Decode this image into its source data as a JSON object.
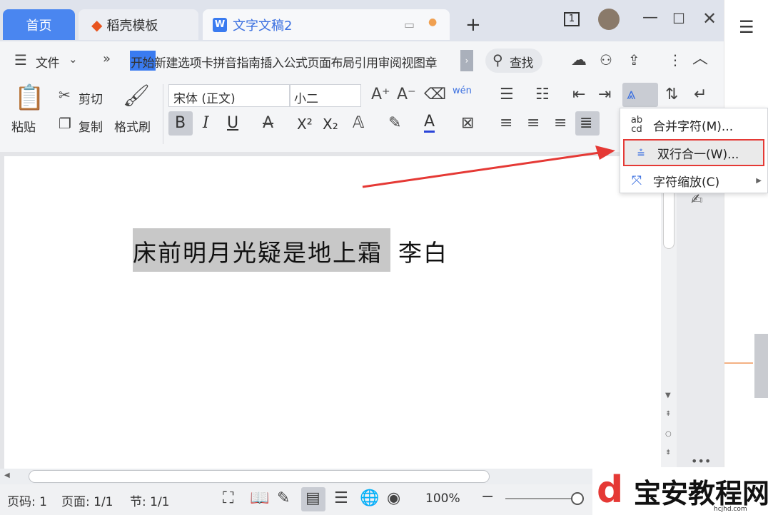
{
  "tabs": {
    "home": "首页",
    "templates": "稻壳模板",
    "document": "文字文稿2",
    "doc_icon": "W"
  },
  "window": {
    "badge": "1"
  },
  "menu": {
    "file": "文件",
    "items": "开始新建选项卡拼音指南插入公式页面布局引用审阅视图章",
    "active": "开始",
    "search": "查找"
  },
  "toolbar": {
    "paste": "粘贴",
    "cut": "剪切",
    "copy": "复制",
    "format_painter": "格式刷",
    "font": "宋体 (正文)",
    "size": "小二",
    "bold": "B",
    "italic": "I",
    "underline": "U",
    "superscript": "X²",
    "subscript": "X₂",
    "font_color": "A",
    "pinyin": "wén"
  },
  "document": {
    "selected_text": "床前明月光疑是地上霜",
    "author": "李白"
  },
  "dropdown": {
    "items": [
      {
        "label": "合并字符(M)...",
        "icon": "ab/cd"
      },
      {
        "label": "双行合一(W)...",
        "icon": "two-lines"
      },
      {
        "label": "字符缩放(C)",
        "icon": "scale"
      }
    ],
    "highlight_color": "#e53935",
    "arrow_color": "#e53935"
  },
  "status": {
    "page_no": "页码: 1",
    "pages": "页面: 1/1",
    "section": "节: 1/1",
    "zoom": "100%"
  },
  "watermark": {
    "name": "宝安教程网",
    "url": "hcjhd.com"
  }
}
